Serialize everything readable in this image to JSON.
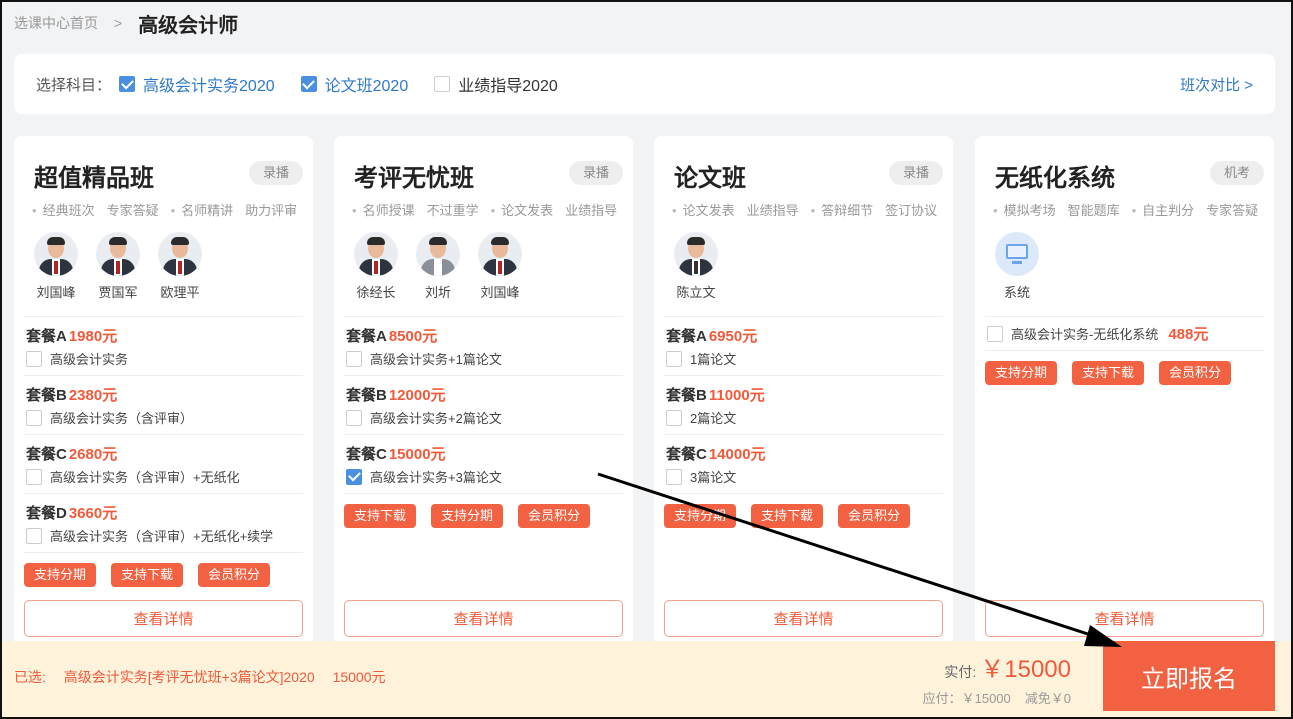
{
  "breadcrumb": {
    "home": "选课中心首页",
    "sep": ">",
    "current": "高级会计师"
  },
  "subjects": {
    "label": "选择科目：",
    "items": [
      {
        "name": "高级会计实务2020",
        "checked": true
      },
      {
        "name": "论文班2020",
        "checked": true
      },
      {
        "name": "业绩指导2020",
        "checked": false
      }
    ],
    "compare": "班次对比 >"
  },
  "cards": [
    {
      "name": "超值精品班",
      "badge": "录播",
      "features": [
        "经典班次",
        "专家答疑",
        "名师精讲",
        "助力评审"
      ],
      "teachers": [
        "刘国峰",
        "贾国军",
        "欧理平"
      ],
      "packages": [
        {
          "title": "套餐A",
          "price": "1980元",
          "option": "高级会计实务",
          "checked": false
        },
        {
          "title": "套餐B",
          "price": "2380元",
          "option": "高级会计实务（含评审）",
          "checked": false
        },
        {
          "title": "套餐C",
          "price": "2680元",
          "option": "高级会计实务（含评审）+无纸化",
          "checked": false
        },
        {
          "title": "套餐D",
          "price": "3660元",
          "option": "高级会计实务（含评审）+无纸化+续学",
          "checked": false
        }
      ],
      "tags": [
        "支持分期",
        "支持下载",
        "会员积分"
      ],
      "detail": "查看详情"
    },
    {
      "name": "考评无忧班",
      "badge": "录播",
      "features": [
        "名师授课",
        "不过重学",
        "论文发表",
        "业绩指导"
      ],
      "teachers": [
        "徐经长",
        "刘圻",
        "刘国峰"
      ],
      "packages": [
        {
          "title": "套餐A",
          "price": "8500元",
          "option": "高级会计实务+1篇论文",
          "checked": false
        },
        {
          "title": "套餐B",
          "price": "12000元",
          "option": "高级会计实务+2篇论文",
          "checked": false
        },
        {
          "title": "套餐C",
          "price": "15000元",
          "option": "高级会计实务+3篇论文",
          "checked": true
        }
      ],
      "tags": [
        "支持下载",
        "支持分期",
        "会员积分"
      ],
      "detail": "查看详情"
    },
    {
      "name": "论文班",
      "badge": "录播",
      "features": [
        "论文发表",
        "业绩指导",
        "答辩细节",
        "签订协议"
      ],
      "teachers": [
        "陈立文"
      ],
      "packages": [
        {
          "title": "套餐A",
          "price": "6950元",
          "option": "1篇论文",
          "checked": false
        },
        {
          "title": "套餐B",
          "price": "11000元",
          "option": "2篇论文",
          "checked": false
        },
        {
          "title": "套餐C",
          "price": "14000元",
          "option": "3篇论文",
          "checked": false
        }
      ],
      "tags": [
        "支持分期",
        "支持下载",
        "会员积分"
      ],
      "detail": "查看详情"
    },
    {
      "name": "无纸化系统",
      "badge": "机考",
      "features": [
        "模拟考场",
        "智能题库",
        "自主判分",
        "专家答疑"
      ],
      "system_label": "系统",
      "system_option": {
        "option": "高级会计实务-无纸化系统",
        "price": "488元",
        "checked": false
      },
      "tags": [
        "支持分期",
        "支持下载",
        "会员积分"
      ],
      "detail": "查看详情"
    }
  ],
  "bottom": {
    "selected_label": "已选:",
    "selected_item": "高级会计实务[考评无忧班+3篇论文]2020",
    "selected_amount": "15000元",
    "actual_label": "实付:",
    "actual_amount": "￥15000",
    "due": "应付：￥15000",
    "discount": "减免￥0",
    "enroll": "立即报名"
  }
}
